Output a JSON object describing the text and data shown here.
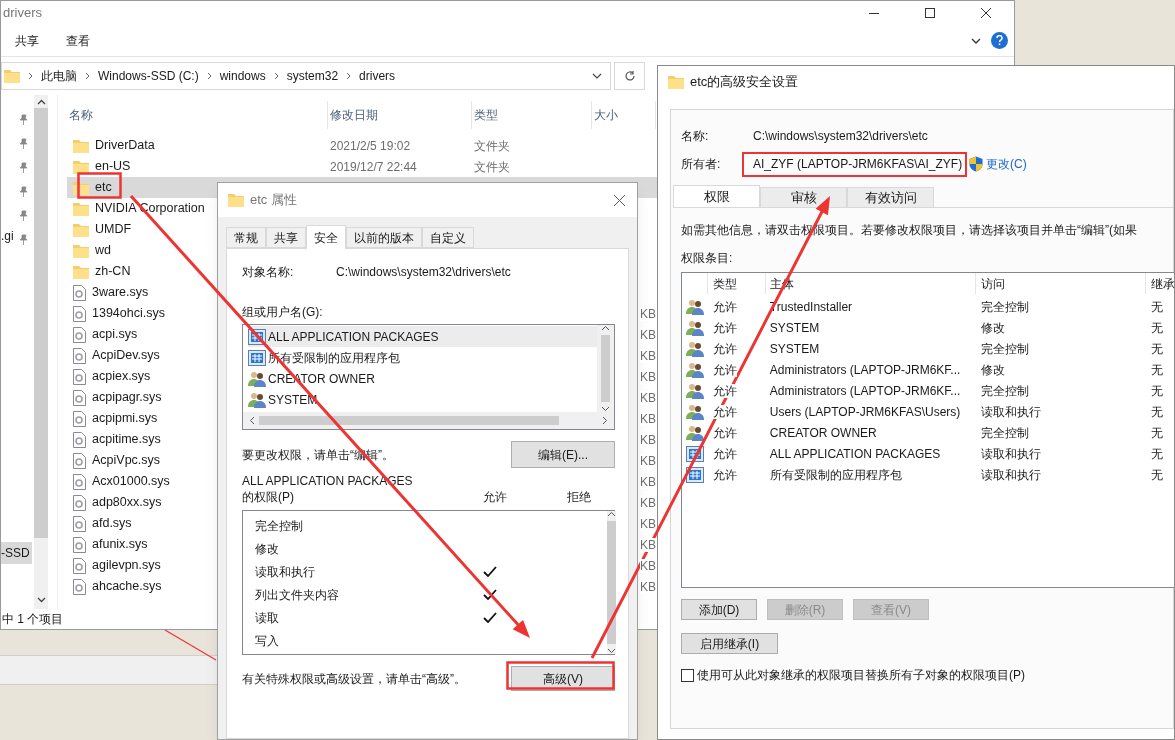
{
  "explorer": {
    "title": "drivers",
    "ribbon_tabs": [
      "共享",
      "查看"
    ],
    "breadcrumbs": [
      "此电脑",
      "Windows-SSD (C:)",
      "windows",
      "system32",
      "drivers"
    ],
    "nav_items": [
      {
        "label": ".gi",
        "selected": false
      },
      {
        "label": "-SSD",
        "selected": true
      }
    ],
    "columns": [
      "名称",
      "修改日期",
      "类型",
      "大小"
    ],
    "rows": [
      {
        "kind": "folder",
        "name": "DriverData",
        "date": "2021/2/5 19:02",
        "type": "文件夹",
        "selected": false
      },
      {
        "kind": "folder",
        "name": "en-US",
        "date": "2019/12/7 22:44",
        "type": "文件夹",
        "selected": false
      },
      {
        "kind": "folder",
        "name": "etc",
        "selected": true
      },
      {
        "kind": "folder",
        "name": "NVIDIA Corporation",
        "selected": false
      },
      {
        "kind": "folder",
        "name": "UMDF",
        "selected": false
      },
      {
        "kind": "folder",
        "name": "wd",
        "selected": false
      },
      {
        "kind": "folder",
        "name": "zh-CN",
        "selected": false
      },
      {
        "kind": "file",
        "name": "3ware.sys",
        "selected": false
      },
      {
        "kind": "file",
        "name": "1394ohci.sys",
        "size": "KB",
        "selected": false
      },
      {
        "kind": "file",
        "name": "acpi.sys",
        "size": "KB",
        "selected": false
      },
      {
        "kind": "file",
        "name": "AcpiDev.sys",
        "size": "KB",
        "selected": false
      },
      {
        "kind": "file",
        "name": "acpiex.sys",
        "size": "KB",
        "selected": false
      },
      {
        "kind": "file",
        "name": "acpipagr.sys",
        "size": "KB",
        "selected": false
      },
      {
        "kind": "file",
        "name": "acpipmi.sys",
        "size": "KB",
        "selected": false
      },
      {
        "kind": "file",
        "name": "acpitime.sys",
        "size": "KB",
        "selected": false
      },
      {
        "kind": "file",
        "name": "AcpiVpc.sys",
        "size": "KB",
        "selected": false
      },
      {
        "kind": "file",
        "name": "Acx01000.sys",
        "size": "KB",
        "selected": false
      },
      {
        "kind": "file",
        "name": "adp80xx.sys",
        "size": "KB",
        "selected": false
      },
      {
        "kind": "file",
        "name": "afd.sys",
        "size": "KB",
        "selected": false
      },
      {
        "kind": "file",
        "name": "afunix.sys",
        "size": "KB",
        "selected": false
      },
      {
        "kind": "file",
        "name": "agilevpn.sys",
        "size": "KB",
        "selected": false
      },
      {
        "kind": "file",
        "name": "ahcache.sys",
        "size": "KB",
        "selected": false
      }
    ],
    "status": "中 1 个项目"
  },
  "properties": {
    "title": "etc 属性",
    "tabs": [
      {
        "label": "常规",
        "selected": false
      },
      {
        "label": "共享",
        "selected": false
      },
      {
        "label": "安全",
        "selected": true
      },
      {
        "label": "以前的版本",
        "selected": false
      },
      {
        "label": "自定义",
        "selected": false
      }
    ],
    "object_label": "对象名称:",
    "object_path": "C:\\windows\\system32\\drivers\\etc",
    "groups_label": "组或用户名(G):",
    "groups": [
      {
        "kind": "package",
        "name": "ALL APPLICATION PACKAGES",
        "selected": true
      },
      {
        "kind": "package",
        "name": "所有受限制的应用程序包",
        "selected": false
      },
      {
        "kind": "users",
        "name": "CREATOR OWNER",
        "selected": false
      },
      {
        "kind": "users",
        "name": "SYSTEM",
        "selected": false
      }
    ],
    "edit_hint": "要更改权限，请单击“编辑”。",
    "edit_button": "编辑(E)...",
    "perm_title": "ALL APPLICATION PACKAGES",
    "perm_label": "的权限(P)",
    "allow_header": "允许",
    "deny_header": "拒绝",
    "permissions": [
      {
        "name": "完全控制",
        "allow": false,
        "deny": false
      },
      {
        "name": "修改",
        "allow": false,
        "deny": false
      },
      {
        "name": "读取和执行",
        "allow": true,
        "deny": false
      },
      {
        "name": "列出文件夹内容",
        "allow": true,
        "deny": false
      },
      {
        "name": "读取",
        "allow": true,
        "deny": false
      },
      {
        "name": "写入",
        "allow": false,
        "deny": false
      }
    ],
    "advanced_hint": "有关特殊权限或高级设置，请单击“高级”。",
    "advanced_button": "高级(V)"
  },
  "advanced": {
    "title": "etc的高级安全设置",
    "name_label": "名称:",
    "name_value": "C:\\windows\\system32\\drivers\\etc",
    "owner_label": "所有者:",
    "owner_value": "AI_ZYF (LAPTOP-JRM6KFAS\\AI_ZYF)",
    "change_link": "更改(C)",
    "tabs": [
      {
        "label": "权限",
        "selected": true
      },
      {
        "label": "审核",
        "selected": false
      },
      {
        "label": "有效访问",
        "selected": false
      }
    ],
    "info": "如需其他信息，请双击权限项目。若要修改权限项目，请选择该项目并单击“编辑”(如果",
    "entries_label": "权限条目:",
    "columns": [
      "类型",
      "主体",
      "访问",
      "继承"
    ],
    "entries": [
      {
        "kind": "users",
        "type": "允许",
        "principal": "TrustedInstaller",
        "access": "完全控制",
        "inherited": "无"
      },
      {
        "kind": "users",
        "type": "允许",
        "principal": "SYSTEM",
        "access": "修改",
        "inherited": "无"
      },
      {
        "kind": "users",
        "type": "允许",
        "principal": "SYSTEM",
        "access": "完全控制",
        "inherited": "无"
      },
      {
        "kind": "users",
        "type": "允许",
        "principal": "Administrators (LAPTOP-JRM6KF...",
        "access": "修改",
        "inherited": "无"
      },
      {
        "kind": "users",
        "type": "允许",
        "principal": "Administrators (LAPTOP-JRM6KF...",
        "access": "完全控制",
        "inherited": "无"
      },
      {
        "kind": "users",
        "type": "允许",
        "principal": "Users (LAPTOP-JRM6KFAS\\Users)",
        "access": "读取和执行",
        "inherited": "无"
      },
      {
        "kind": "users",
        "type": "允许",
        "principal": "CREATOR OWNER",
        "access": "完全控制",
        "inherited": "无"
      },
      {
        "kind": "package",
        "type": "允许",
        "principal": "ALL APPLICATION PACKAGES",
        "access": "读取和执行",
        "inherited": "无"
      },
      {
        "kind": "package",
        "type": "允许",
        "principal": "所有受限制的应用程序包",
        "access": "读取和执行",
        "inherited": "无"
      }
    ],
    "buttons": [
      {
        "label": "添加(D)",
        "disabled": false
      },
      {
        "label": "删除(R)",
        "disabled": true
      },
      {
        "label": "查看(V)",
        "disabled": true
      }
    ],
    "inherit_button": "启用继承(I)",
    "replace_checkbox": {
      "label": "使用可从此对象继承的权限项目替换所有子对象的权限项目(P)",
      "checked": false
    }
  }
}
